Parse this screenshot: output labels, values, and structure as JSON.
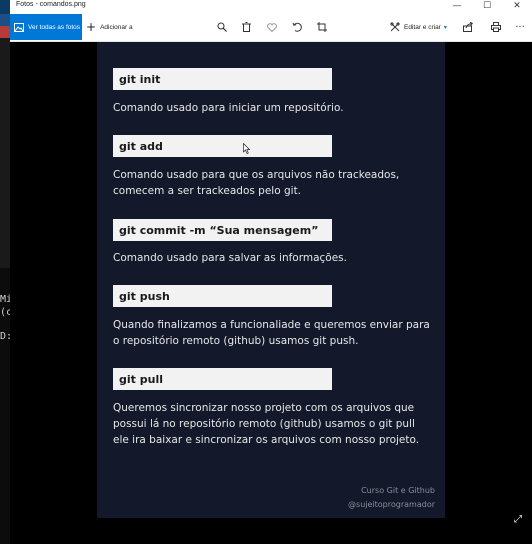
{
  "background": {
    "terminal_lines": [
      "Mi",
      "(c",
      "D:"
    ]
  },
  "window": {
    "title": "Fotos - comandos.png",
    "controls": {
      "minimize": "—",
      "maximize": "☐",
      "close": "✕"
    }
  },
  "toolbar": {
    "all_photos_label": "Ver todas as fotos",
    "add_label": "Adicionar a",
    "add_symbol": "+",
    "edit_label": "Editar e criar",
    "edit_chevron": "▾",
    "icons": [
      "photo-icon",
      "zoom-icon",
      "delete-icon",
      "favorite-icon",
      "rotate-icon",
      "crop-icon",
      "edit-create-icon",
      "share-icon",
      "print-icon",
      "more-icon"
    ],
    "more_symbol": "···",
    "accent": "#0078d7"
  },
  "photo": {
    "background": "#13182a",
    "commands": [
      {
        "cmd": "git init",
        "desc": "Comando usado para iniciar um repositório."
      },
      {
        "cmd": "git add",
        "desc": "Comando usado para que os arquivos não trackeados, comecem a ser trackeados pelo git."
      },
      {
        "cmd": "git commit -m “Sua mensagem”",
        "desc": "Comando usado para salvar as informações."
      },
      {
        "cmd": "git push",
        "desc": "Quando finalizamos a funcionaliade e queremos enviar para o repositório remoto (github) usamos git push."
      },
      {
        "cmd": "git pull",
        "desc": "Queremos sincronizar nosso projeto com os arquivos que possui lá no repositório remoto (github) usamos o git pull ele ira baixar e sincronizar os arquivos com nosso projeto."
      }
    ],
    "credit_line1": "Curso Git e Github",
    "credit_line2": "@sujeitoprogramador"
  },
  "viewer": {
    "expand_symbol": "⤢"
  }
}
